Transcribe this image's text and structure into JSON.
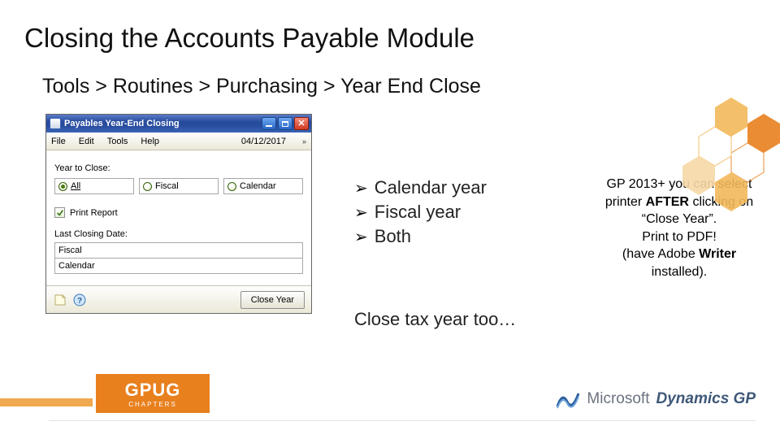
{
  "slide": {
    "title": "Closing the Accounts Payable Module",
    "breadcrumb": "Tools > Routines > Purchasing > Year End Close",
    "bullets": [
      "Calendar year",
      "Fiscal year",
      "Both"
    ],
    "close_tax": "Close tax year too…",
    "note": {
      "line1": "GP 2013+ you can select printer ",
      "bold1": "AFTER",
      "line2": " clicking on “Close Year”.",
      "line3": "Print to PDF!",
      "line4": "(have Adobe ",
      "bold2": "Writer",
      "line5": " installed)."
    }
  },
  "window": {
    "title": "Payables Year-End Closing",
    "menus": [
      "File",
      "Edit",
      "Tools",
      "Help"
    ],
    "date": "04/12/2017",
    "year_to_close_label": "Year to Close:",
    "year_options": [
      {
        "label": "All",
        "selected": true
      },
      {
        "label": "Fiscal",
        "selected": false
      },
      {
        "label": "Calendar",
        "selected": false
      }
    ],
    "print_report_label": "Print Report",
    "print_report_checked": true,
    "last_closing_label": "Last Closing Date:",
    "last_closing_rows": [
      "Fiscal",
      "Calendar"
    ],
    "close_year_button": "Close Year"
  },
  "footer": {
    "gpug": "GPUG",
    "gpug_sub": "CHAPTERS",
    "ms": "Microsoft",
    "dyn": "Dynamics GP"
  },
  "colors": {
    "accent_orange": "#e8801e",
    "accent_light": "#f3b95a",
    "brand_blue": "#2b5f9e"
  }
}
